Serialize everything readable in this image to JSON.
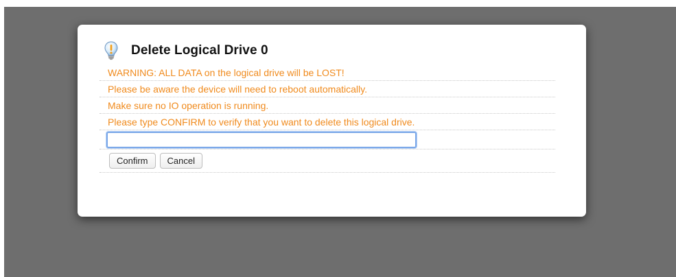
{
  "dialog": {
    "title": "Delete Logical Drive 0",
    "icon": "lightbulb-warning-icon",
    "messages": [
      "WARNING: ALL DATA on the logical drive will be LOST!",
      "Please be aware the device will need to reboot automatically.",
      "Make sure no IO operation is running.",
      "Please type CONFIRM to verify that you want to delete this logical drive."
    ],
    "input_value": "",
    "buttons": {
      "confirm": "Confirm",
      "cancel": "Cancel"
    }
  },
  "colors": {
    "warning_text": "#f08a1c",
    "overlay": "#6e6e6e",
    "input_focus": "#7aa7e8"
  }
}
